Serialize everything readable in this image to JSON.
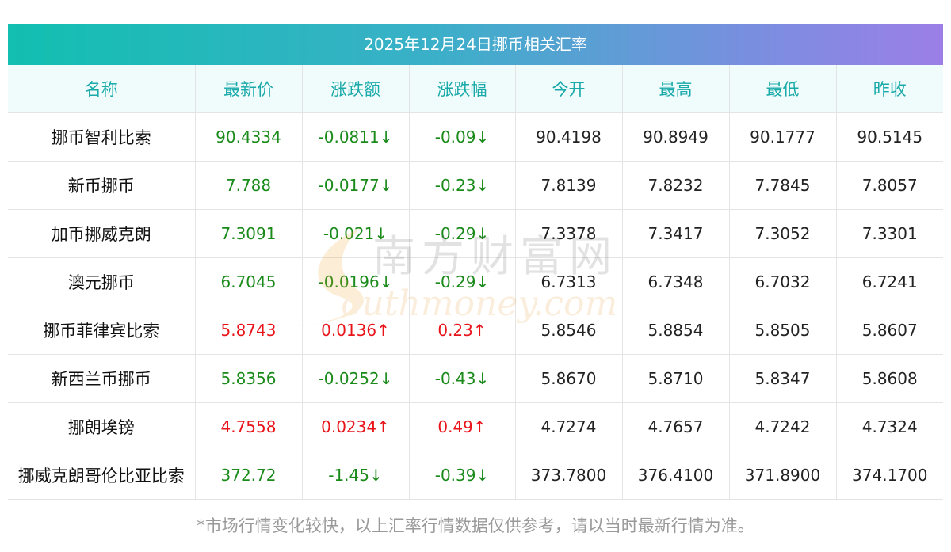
{
  "title": "2025年12月24日挪币相关汇率",
  "headers": [
    "名称",
    "最新价",
    "涨跌额",
    "涨跌幅",
    "今开",
    "最高",
    "最低",
    "昨收"
  ],
  "rows": [
    {
      "name": "挪币智利比索",
      "latest": "90.4334",
      "change": "-0.0811↓",
      "pct": "-0.09↓",
      "open": "90.4198",
      "high": "90.8949",
      "low": "90.1777",
      "prev": "90.5145",
      "trend": "down"
    },
    {
      "name": "新币挪币",
      "latest": "7.788",
      "change": "-0.0177↓",
      "pct": "-0.23↓",
      "open": "7.8139",
      "high": "7.8232",
      "low": "7.7845",
      "prev": "7.8057",
      "trend": "down"
    },
    {
      "name": "加币挪威克朗",
      "latest": "7.3091",
      "change": "-0.021↓",
      "pct": "-0.29↓",
      "open": "7.3378",
      "high": "7.3417",
      "low": "7.3052",
      "prev": "7.3301",
      "trend": "down"
    },
    {
      "name": "澳元挪币",
      "latest": "6.7045",
      "change": "-0.0196↓",
      "pct": "-0.29↓",
      "open": "6.7313",
      "high": "6.7348",
      "low": "6.7032",
      "prev": "6.7241",
      "trend": "down"
    },
    {
      "name": "挪币菲律宾比索",
      "latest": "5.8743",
      "change": "0.0136↑",
      "pct": "0.23↑",
      "open": "5.8546",
      "high": "5.8854",
      "low": "5.8505",
      "prev": "5.8607",
      "trend": "up"
    },
    {
      "name": "新西兰币挪币",
      "latest": "5.8356",
      "change": "-0.0252↓",
      "pct": "-0.43↓",
      "open": "5.8670",
      "high": "5.8710",
      "low": "5.8347",
      "prev": "5.8608",
      "trend": "down"
    },
    {
      "name": "挪朗埃镑",
      "latest": "4.7558",
      "change": "0.0234↑",
      "pct": "0.49↑",
      "open": "4.7274",
      "high": "4.7657",
      "low": "4.7242",
      "prev": "4.7324",
      "trend": "up"
    },
    {
      "name": "挪威克朗哥伦比亚比索",
      "latest": "372.72",
      "change": "-1.45↓",
      "pct": "-0.39↓",
      "open": "373.7800",
      "high": "376.4100",
      "low": "371.8900",
      "prev": "374.1700",
      "trend": "down"
    }
  ],
  "watermark": {
    "cn": "南方财富网",
    "en": "outhmoney.com"
  },
  "note": "*市场行情变化较快，以上汇率行情数据仅供参考，请以当时最新行情为准。",
  "colors": {
    "up": "#e8141a",
    "down": "#1a8a1a",
    "header_text": "#1aa9a9"
  }
}
